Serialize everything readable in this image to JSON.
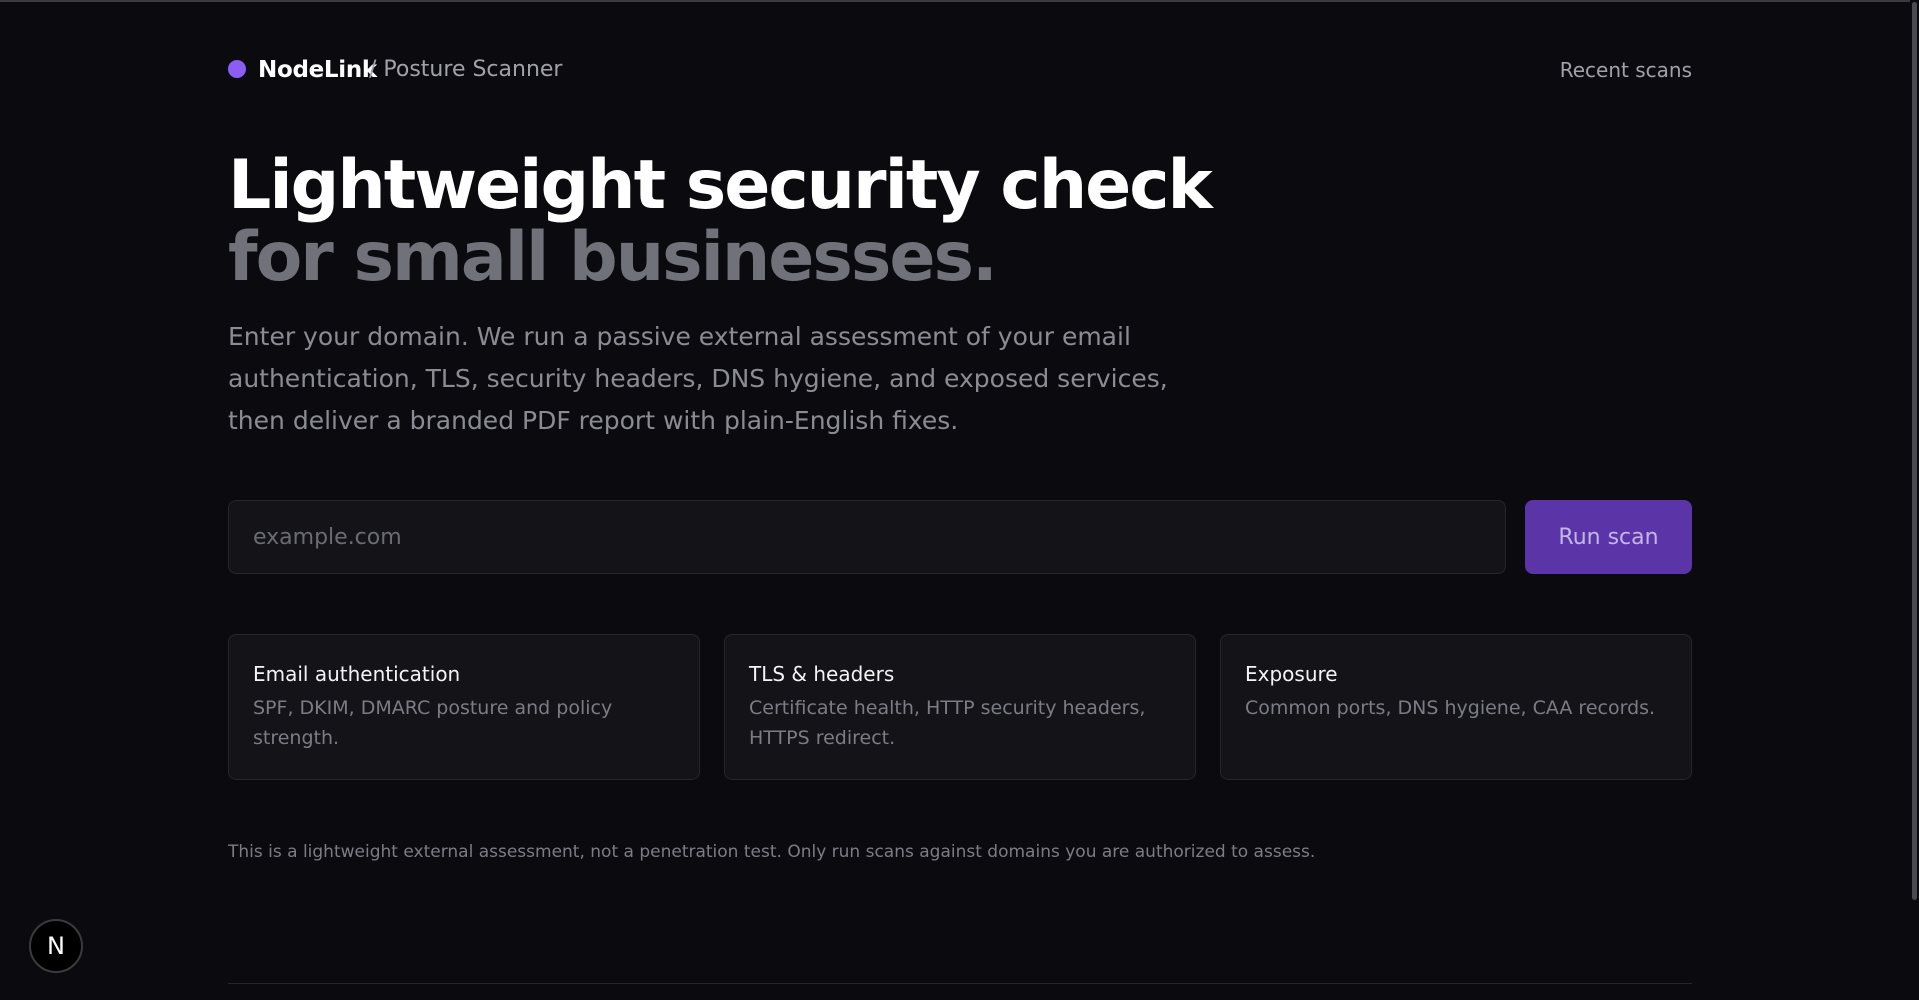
{
  "header": {
    "brand_name": "NodeLink",
    "brand_sub": "/ Posture Scanner",
    "recent_scans_label": "Recent scans"
  },
  "hero": {
    "line1": "Lightweight security check",
    "line2": "for small businesses.",
    "description": "Enter your domain. We run a passive external assessment of your email authentication, TLS, security headers, DNS hygiene, and exposed services, then deliver a branded PDF report with plain-English fixes."
  },
  "scan_form": {
    "input_placeholder": "example.com",
    "input_value": "",
    "button_label": "Run scan"
  },
  "cards": [
    {
      "title": "Email authentication",
      "description": "SPF, DKIM, DMARC posture and policy strength."
    },
    {
      "title": "TLS & headers",
      "description": "Certificate health, HTTP security headers, HTTPS redirect."
    },
    {
      "title": "Exposure",
      "description": "Common ports, DNS hygiene, CAA records."
    }
  ],
  "disclaimer": "This is a lightweight external assessment, not a penetration test. Only run scans against domains you are authorized to assess.",
  "next_badge_letter": "N",
  "colors": {
    "background": "#0b0b0f",
    "brand_dot": "#8b5cf6",
    "button": "#5b34a8",
    "card_bg": "#131318"
  }
}
